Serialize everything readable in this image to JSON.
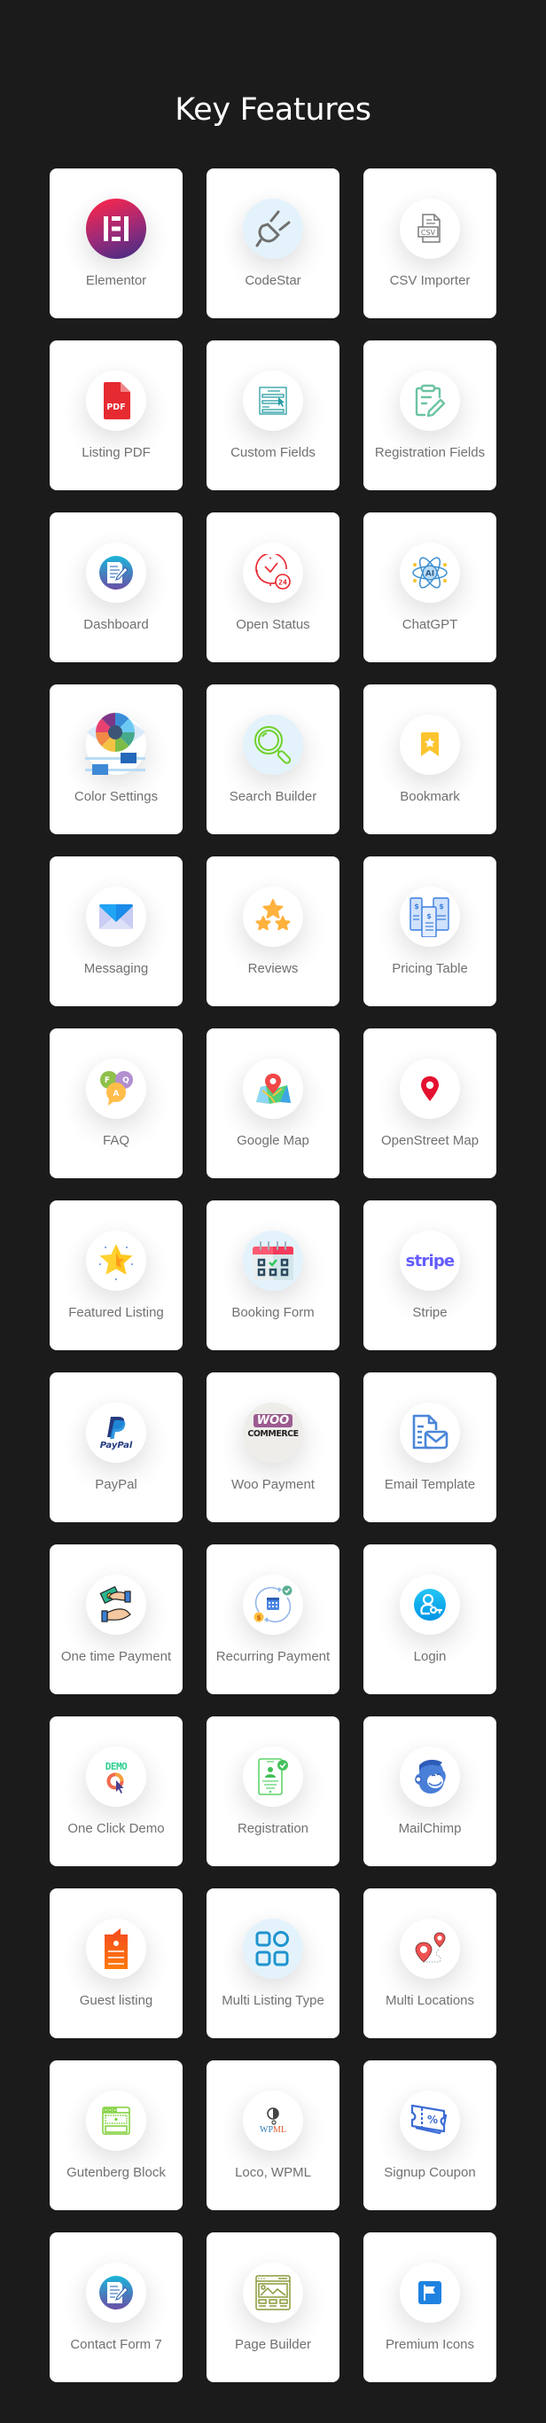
{
  "page": {
    "title": "Key Features"
  },
  "features": [
    {
      "label": "Elementor",
      "icon": "elementor-icon"
    },
    {
      "label": "CodeStar",
      "icon": "plug-icon"
    },
    {
      "label": "CSV Importer",
      "icon": "csv-file-icon"
    },
    {
      "label": "Listing PDF",
      "icon": "pdf-file-icon"
    },
    {
      "label": "Custom Fields",
      "icon": "form-fields-icon"
    },
    {
      "label": "Registration Fields",
      "icon": "clipboard-edit-icon"
    },
    {
      "label": "Dashboard",
      "icon": "document-edit-icon"
    },
    {
      "label": "Open Status",
      "icon": "clock-24-icon"
    },
    {
      "label": "ChatGPT",
      "icon": "ai-atom-icon"
    },
    {
      "label": "Color Settings",
      "icon": "color-wheel-eye-icon"
    },
    {
      "label": "Search Builder",
      "icon": "magnifier-icon"
    },
    {
      "label": "Bookmark",
      "icon": "bookmark-star-icon"
    },
    {
      "label": "Messaging",
      "icon": "envelope-icon"
    },
    {
      "label": "Reviews",
      "icon": "three-stars-icon"
    },
    {
      "label": "Pricing Table",
      "icon": "pricing-table-icon"
    },
    {
      "label": "FAQ",
      "icon": "faq-bubbles-icon"
    },
    {
      "label": "Google Map",
      "icon": "map-pin-icon"
    },
    {
      "label": "OpenStreet Map",
      "icon": "location-pin-icon"
    },
    {
      "label": "Featured Listing",
      "icon": "star-icon"
    },
    {
      "label": "Booking Form",
      "icon": "calendar-check-icon"
    },
    {
      "label": "Stripe",
      "icon": "stripe-logo-icon",
      "icon_text": "stripe"
    },
    {
      "label": "PayPal",
      "icon": "paypal-logo-icon",
      "icon_text": "PayPal"
    },
    {
      "label": "Woo Payment",
      "icon": "woocommerce-logo-icon",
      "icon_text": "WOO",
      "icon_subtext": "COMMERCE"
    },
    {
      "label": "Email Template",
      "icon": "email-document-icon"
    },
    {
      "label": "One time Payment",
      "icon": "hand-money-icon"
    },
    {
      "label": "Recurring Payment",
      "icon": "recurring-calendar-icon"
    },
    {
      "label": "Login",
      "icon": "user-key-icon"
    },
    {
      "label": "One Click Demo",
      "icon": "demo-click-icon",
      "icon_text": "DEMO"
    },
    {
      "label": "Registration",
      "icon": "user-card-check-icon"
    },
    {
      "label": "MailChimp",
      "icon": "mailchimp-logo-icon"
    },
    {
      "label": "Guest listing",
      "icon": "guest-document-icon"
    },
    {
      "label": "Multi Listing Type",
      "icon": "grid-shapes-icon"
    },
    {
      "label": "Multi Locations",
      "icon": "multi-pin-icon"
    },
    {
      "label": "Gutenberg Block",
      "icon": "block-layout-icon"
    },
    {
      "label": "Loco, WPML",
      "icon": "wpml-logo-icon",
      "icon_text": "WP",
      "icon_subtext": "ML"
    },
    {
      "label": "Signup Coupon",
      "icon": "coupon-icon",
      "icon_text": "%"
    },
    {
      "label": "Contact Form 7",
      "icon": "document-edit-icon"
    },
    {
      "label": "Page Builder",
      "icon": "page-layout-icon"
    },
    {
      "label": "Premium Icons",
      "icon": "flag-icon"
    }
  ],
  "colors": {
    "background": "#1b1b1b",
    "card": "#ffffff",
    "label": "#717171",
    "title": "#ffffff"
  }
}
